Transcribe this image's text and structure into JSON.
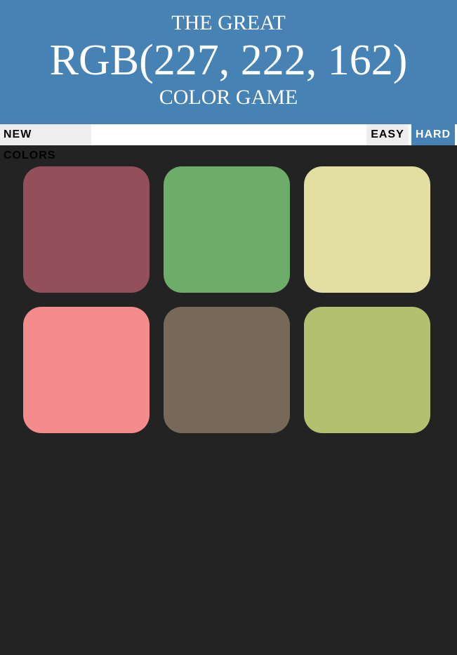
{
  "header": {
    "line1": "THE GREAT",
    "target_color": "RGB(227, 222, 162)",
    "line3": "COLOR GAME"
  },
  "controls": {
    "new_colors": "NEW COLORS",
    "message": "",
    "easy": "EASY",
    "hard": "HARD",
    "selected_mode": "HARD"
  },
  "squares": [
    "#934f5a",
    "#6dac6b",
    "#e3dea2",
    "#f48b8d",
    "#76695a",
    "#b2c06f"
  ],
  "colors": {
    "header": "#4682b4",
    "background": "#232323"
  }
}
